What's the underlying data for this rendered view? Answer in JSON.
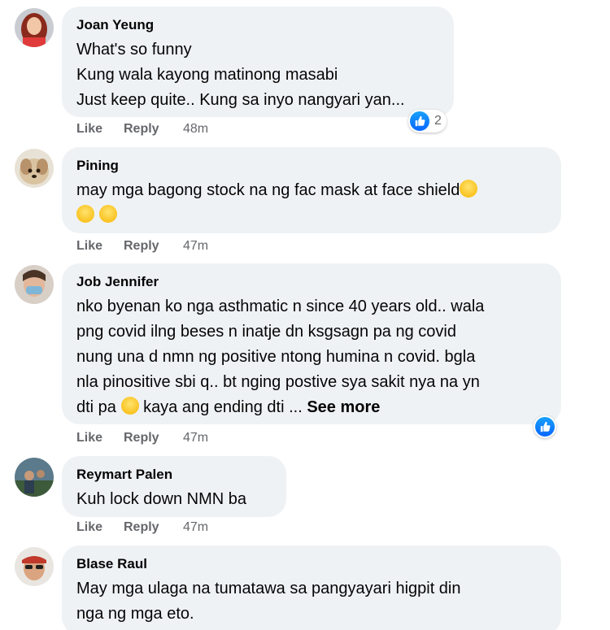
{
  "comments": [
    {
      "author": "Joan Yeung",
      "lines": [
        "What's so funny",
        "Kung wala kayong matinong masabi",
        "Just keep quite.. Kung sa inyo nangyari yan..."
      ],
      "like_label": "Like",
      "reply_label": "Reply",
      "time": "48m",
      "reaction_count": "2"
    },
    {
      "author": "Pining",
      "lines": [
        "may mga bagong stock na ng fac mask at face shield"
      ],
      "like_label": "Like",
      "reply_label": "Reply",
      "time": "47m"
    },
    {
      "author": "Job Jennifer",
      "lines": [
        "nko byenan ko nga asthmatic n since 40 years old.. wala",
        "png covid ilng beses n inatje dn ksgsagn pa ng covid",
        "nung una d nmn ng positive ntong humina n covid. bgla",
        "nla pinositive sbi q.. bt nging postive sya sakit nya na yn",
        "dti pa",
        "kaya ang ending dti ... "
      ],
      "see_more": "See more",
      "like_label": "Like",
      "reply_label": "Reply",
      "time": "47m"
    },
    {
      "author": "Reymart Palen",
      "lines": [
        "Kuh lock down NMN ba"
      ],
      "like_label": "Like",
      "reply_label": "Reply",
      "time": "47m"
    },
    {
      "author": "Blase Raul",
      "lines": [
        "May mga ulaga na tumatawa sa pangyayari higpit din",
        "nga ng mga eto."
      ]
    }
  ],
  "icons": {
    "like_reaction": "thumbs-up-icon",
    "laughing_emoji": "grinning-sweat-emoji",
    "pensive_emoji": "pensive-face-emoji"
  },
  "colors": {
    "bubble": "#eff2f5",
    "meta_text": "#65676b",
    "like_blue": "#0866ff"
  }
}
